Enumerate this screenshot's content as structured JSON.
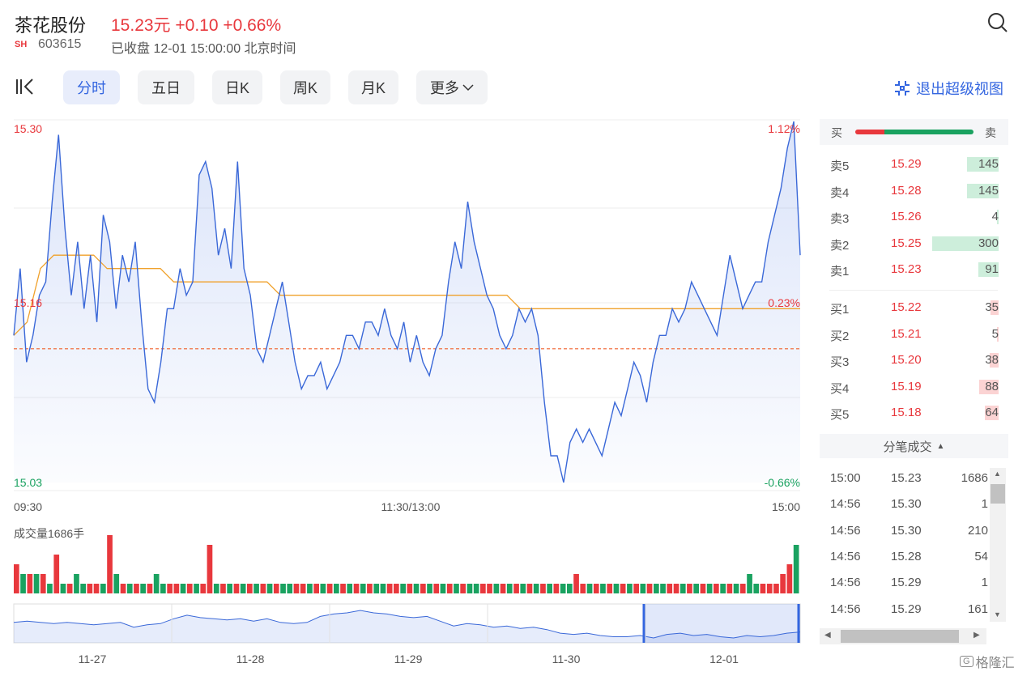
{
  "header": {
    "title": "茶花股份",
    "price_line": "15.23元 +0.10 +0.66%",
    "exchange": "SH",
    "code": "603615",
    "status": "已收盘 12-01 15:00:00 北京时间"
  },
  "toolbar": {
    "tabs": [
      "分时",
      "五日",
      "日K",
      "周K",
      "月K",
      "更多"
    ],
    "active": 0,
    "exit_label": "退出超级视图"
  },
  "chart_data": {
    "type": "line",
    "price_axis": {
      "top": "15.30",
      "mid": "15.16",
      "bottom": "15.03"
    },
    "pct_axis": {
      "top": "1.12%",
      "mid": "0.23%",
      "bottom": "-0.66%"
    },
    "ylim": [
      15.03,
      15.3
    ],
    "prev_close": 15.13,
    "x_ticks": [
      "09:30",
      "11:30/13:00",
      "15:00"
    ],
    "price": [
      15.14,
      15.19,
      15.12,
      15.14,
      15.17,
      15.18,
      15.24,
      15.29,
      15.22,
      15.17,
      15.21,
      15.16,
      15.2,
      15.15,
      15.23,
      15.21,
      15.16,
      15.2,
      15.18,
      15.21,
      15.15,
      15.1,
      15.09,
      15.12,
      15.16,
      15.16,
      15.19,
      15.17,
      15.18,
      15.26,
      15.27,
      15.25,
      15.2,
      15.22,
      15.19,
      15.27,
      15.19,
      15.17,
      15.13,
      15.12,
      15.14,
      15.16,
      15.18,
      15.15,
      15.12,
      15.1,
      15.11,
      15.11,
      15.12,
      15.1,
      15.11,
      15.12,
      15.14,
      15.14,
      15.13,
      15.15,
      15.15,
      15.14,
      15.16,
      15.14,
      15.13,
      15.15,
      15.12,
      15.14,
      15.12,
      15.11,
      15.13,
      15.14,
      15.18,
      15.21,
      15.19,
      15.24,
      15.21,
      15.19,
      15.17,
      15.16,
      15.14,
      15.13,
      15.14,
      15.16,
      15.15,
      15.16,
      15.14,
      15.09,
      15.05,
      15.05,
      15.03,
      15.06,
      15.07,
      15.06,
      15.07,
      15.06,
      15.05,
      15.07,
      15.09,
      15.08,
      15.1,
      15.12,
      15.11,
      15.09,
      15.12,
      15.14,
      15.14,
      15.16,
      15.15,
      15.16,
      15.18,
      15.17,
      15.16,
      15.15,
      15.14,
      15.17,
      15.2,
      15.18,
      15.16,
      15.17,
      15.18,
      15.18,
      15.21,
      15.23,
      15.25,
      15.28,
      15.3,
      15.2
    ],
    "avg": [
      15.14,
      15.15,
      15.19,
      15.2,
      15.2,
      15.2,
      15.2,
      15.19,
      15.19,
      15.19,
      15.19,
      15.19,
      15.18,
      15.18,
      15.18,
      15.18,
      15.18,
      15.18,
      15.18,
      15.18,
      15.17,
      15.17,
      15.17,
      15.17,
      15.17,
      15.17,
      15.17,
      15.17,
      15.17,
      15.17,
      15.17,
      15.17,
      15.17,
      15.17,
      15.17,
      15.17,
      15.17,
      15.17,
      15.16,
      15.16,
      15.16,
      15.16,
      15.16,
      15.16,
      15.16,
      15.16,
      15.16,
      15.16,
      15.16,
      15.16,
      15.16,
      15.16,
      15.16,
      15.16,
      15.16,
      15.16,
      15.16,
      15.16,
      15.16,
      15.16
    ],
    "volume_label": "成交量1686手",
    "volume": [
      3,
      2,
      2,
      2,
      2,
      1,
      4,
      1,
      1,
      2,
      1,
      1,
      1,
      1,
      6,
      2,
      1,
      1,
      1,
      1,
      1,
      2,
      1,
      1,
      1,
      1,
      1,
      1,
      1,
      5,
      1,
      1,
      1,
      1,
      1,
      1,
      1,
      1,
      1,
      1,
      1,
      1,
      1,
      1,
      1,
      1,
      1,
      1,
      1,
      1,
      1,
      1,
      1,
      1,
      1,
      1,
      1,
      1,
      1,
      1,
      1,
      1,
      1,
      1,
      1,
      1,
      1,
      1,
      1,
      1,
      1,
      1,
      1,
      1,
      1,
      1,
      1,
      1,
      1,
      1,
      1,
      1,
      1,
      1,
      2,
      1,
      1,
      1,
      1,
      1,
      1,
      1,
      1,
      1,
      1,
      1,
      1,
      1,
      1,
      1,
      1,
      1,
      1,
      1,
      1,
      1,
      1,
      1,
      1,
      1,
      2,
      1,
      1,
      1,
      1,
      2,
      3,
      5
    ],
    "volume_up": [
      true,
      false,
      true,
      false,
      true,
      false,
      true,
      false,
      true,
      false,
      false,
      true,
      true,
      false,
      true,
      false,
      true,
      false,
      true,
      false,
      true,
      false,
      false,
      true,
      true,
      false,
      true,
      false,
      true,
      true,
      false,
      true,
      false,
      true,
      false,
      true,
      false,
      true,
      false,
      true,
      false,
      false,
      true,
      true,
      false,
      true,
      false,
      true,
      false,
      true,
      false,
      true,
      false,
      true,
      false,
      false,
      true,
      true,
      false,
      true,
      false,
      true,
      false,
      true,
      false,
      true,
      false,
      true,
      false,
      false,
      true,
      true,
      false,
      true,
      false,
      true,
      false,
      true,
      false,
      true,
      false,
      true,
      false,
      false,
      true,
      true,
      false,
      true,
      false,
      true,
      false,
      true,
      false,
      true,
      false,
      true,
      false,
      false,
      true,
      true,
      false,
      true,
      false,
      true,
      false,
      true,
      false,
      true,
      false,
      true,
      false,
      false,
      true,
      true,
      true,
      true,
      true,
      false
    ],
    "overview_x": [
      "11-27",
      "11-28",
      "11-29",
      "11-30",
      "12-01"
    ],
    "overview": [
      15.3,
      15.31,
      15.3,
      15.29,
      15.3,
      15.29,
      15.28,
      15.29,
      15.3,
      15.26,
      15.28,
      15.29,
      15.33,
      15.36,
      15.34,
      15.33,
      15.32,
      15.33,
      15.31,
      15.33,
      15.3,
      15.29,
      15.3,
      15.35,
      15.37,
      15.38,
      15.4,
      15.38,
      15.37,
      15.35,
      15.34,
      15.35,
      15.31,
      15.27,
      15.29,
      15.28,
      15.26,
      15.27,
      15.25,
      15.26,
      15.24,
      15.21,
      15.2,
      15.21,
      15.19,
      15.18,
      15.18,
      15.19,
      15.17,
      15.2,
      15.21,
      15.19,
      15.2,
      15.18,
      15.17,
      15.19,
      15.18,
      15.19,
      15.21,
      15.22
    ]
  },
  "orderbook": {
    "buy_label": "买",
    "sell_label": "卖",
    "asks": [
      {
        "label": "卖5",
        "price": "15.29",
        "vol": "145"
      },
      {
        "label": "卖4",
        "price": "15.28",
        "vol": "145"
      },
      {
        "label": "卖3",
        "price": "15.26",
        "vol": "4"
      },
      {
        "label": "卖2",
        "price": "15.25",
        "vol": "300"
      },
      {
        "label": "卖1",
        "price": "15.23",
        "vol": "91"
      }
    ],
    "bids": [
      {
        "label": "买1",
        "price": "15.22",
        "vol": "35"
      },
      {
        "label": "买2",
        "price": "15.21",
        "vol": "5"
      },
      {
        "label": "买3",
        "price": "15.20",
        "vol": "38"
      },
      {
        "label": "买4",
        "price": "15.19",
        "vol": "88"
      },
      {
        "label": "买5",
        "price": "15.18",
        "vol": "64"
      }
    ],
    "ask_fill": [
      0.48,
      0.48,
      0.01,
      1.0,
      0.3
    ],
    "bid_fill": [
      0.12,
      0.02,
      0.13,
      0.29,
      0.21
    ]
  },
  "trades": {
    "title": "分笔成交",
    "rows": [
      {
        "time": "15:00",
        "price": "15.23",
        "vol": "1686"
      },
      {
        "time": "14:56",
        "price": "15.30",
        "vol": "1"
      },
      {
        "time": "14:56",
        "price": "15.30",
        "vol": "210"
      },
      {
        "time": "14:56",
        "price": "15.28",
        "vol": "54"
      },
      {
        "time": "14:56",
        "price": "15.29",
        "vol": "1"
      },
      {
        "time": "14:56",
        "price": "15.29",
        "vol": "161"
      }
    ]
  },
  "watermark": "格隆汇",
  "colors": {
    "accent": "#3466e0",
    "up": "#e8383d",
    "down": "#1aa260",
    "avg": "#f0a12b"
  }
}
